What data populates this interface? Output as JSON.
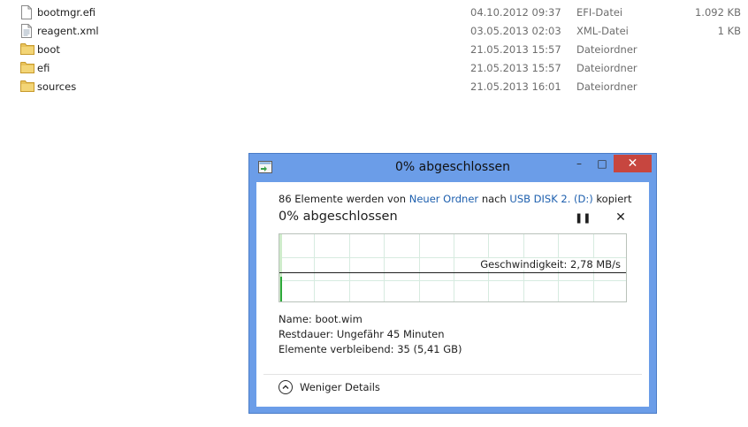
{
  "explorer": {
    "files": [
      {
        "name": "bootmgr.efi",
        "date": "04.10.2012 09:37",
        "type": "EFI-Datei",
        "size": "1.092 KB",
        "icon": "file-icon"
      },
      {
        "name": "reagent.xml",
        "date": "03.05.2013 02:03",
        "type": "XML-Datei",
        "size": "1 KB",
        "icon": "document-icon"
      },
      {
        "name": "boot",
        "date": "21.05.2013 15:57",
        "type": "Dateiordner",
        "size": "",
        "icon": "folder-icon"
      },
      {
        "name": "efi",
        "date": "21.05.2013 15:57",
        "type": "Dateiordner",
        "size": "",
        "icon": "folder-icon"
      },
      {
        "name": "sources",
        "date": "21.05.2013 16:01",
        "type": "Dateiordner",
        "size": "",
        "icon": "folder-icon"
      }
    ]
  },
  "dialog": {
    "title": "0% abgeschlossen",
    "copy_prefix": "86 Elemente werden von",
    "copy_source": "Neuer Ordner",
    "copy_mid": "nach",
    "copy_dest": "USB DISK 2. (D:)",
    "copy_suffix": "kopiert",
    "status": "0% abgeschlossen",
    "progress_fraction": 0.0,
    "speed_label": "Geschwindigkeit: 2,78 MB/s",
    "name_label": "Name:",
    "name_value": "boot.wim",
    "remaining_label": "Restdauer:",
    "remaining_value": "Ungefähr 45 Minuten",
    "items_label": "Elemente verbleibend:",
    "items_value": "35 (5,41 GB)",
    "toggle_label": "Weniger Details",
    "colors": {
      "frame": "#6b9de8",
      "close": "#c7463f",
      "link": "#1d5fae",
      "graph_fill": "#2ea83a"
    }
  }
}
